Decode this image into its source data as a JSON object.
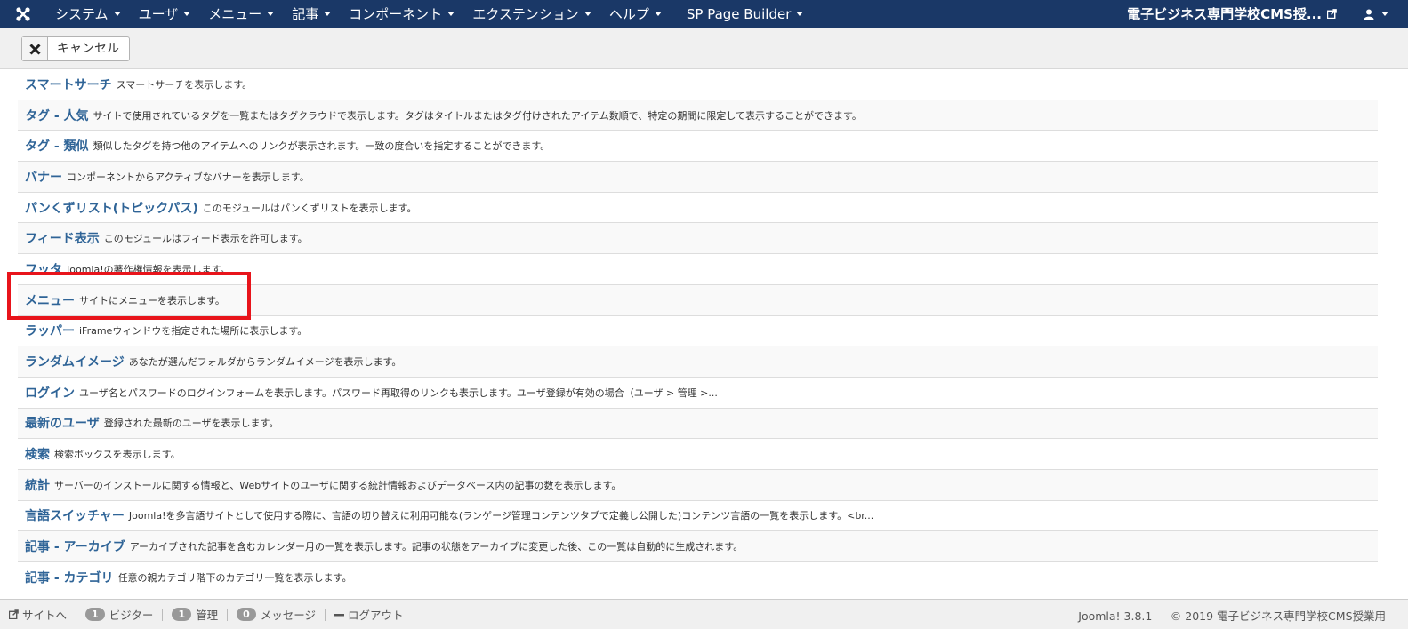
{
  "navbar": {
    "menus": [
      {
        "label": "システム"
      },
      {
        "label": "ユーザ"
      },
      {
        "label": "メニュー"
      },
      {
        "label": "記事"
      },
      {
        "label": "コンポーネント"
      },
      {
        "label": "エクステンション"
      },
      {
        "label": "ヘルプ"
      }
    ],
    "sp_page_builder": "SP Page Builder",
    "site_title": "電子ビジネス専門学校CMS授..."
  },
  "toolbar": {
    "cancel_label": "キャンセル"
  },
  "modules": [
    {
      "title": "スマートサーチ",
      "desc": "スマートサーチを表示します。"
    },
    {
      "title": "タグ - 人気",
      "desc": "サイトで使用されているタグを一覧またはタグクラウドで表示します。タグはタイトルまたはタグ付けされたアイテム数順で、特定の期間に限定して表示することができます。"
    },
    {
      "title": "タグ - 類似",
      "desc": "類似したタグを持つ他のアイテムへのリンクが表示されます。一致の度合いを指定することができます。"
    },
    {
      "title": "バナー",
      "desc": "コンポーネントからアクティブなバナーを表示します。"
    },
    {
      "title": "パンくずリスト(トピックパス)",
      "desc": "このモジュールはパンくずリストを表示します。"
    },
    {
      "title": "フィード表示",
      "desc": "このモジュールはフィード表示を許可します。"
    },
    {
      "title": "フッタ",
      "desc": "Joomla!の著作権情報を表示します。"
    },
    {
      "title": "メニュー",
      "desc": "サイトにメニューを表示します。"
    },
    {
      "title": "ラッパー",
      "desc": "iFrameウィンドウを指定された場所に表示します。"
    },
    {
      "title": "ランダムイメージ",
      "desc": "あなたが選んだフォルダからランダムイメージを表示します。"
    },
    {
      "title": "ログイン",
      "desc": "ユーザ名とパスワードのログインフォームを表示します。パスワード再取得のリンクも表示します。ユーザ登録が有効の場合（ユーザ > 管理 >..."
    },
    {
      "title": "最新のユーザ",
      "desc": "登録された最新のユーザを表示します。"
    },
    {
      "title": "検索",
      "desc": "検索ボックスを表示します。"
    },
    {
      "title": "統計",
      "desc": "サーバーのインストールに関する情報と、Webサイトのユーザに関する統計情報およびデータベース内の記事の数を表示します。"
    },
    {
      "title": "言語スイッチャー",
      "desc": "Joomla!を多言語サイトとして使用する際に、言語の切り替えに利用可能な(ランゲージ管理コンテンツタブで定義し公開した)コンテンツ言語の一覧を表示します。<br..."
    },
    {
      "title": "記事 - アーカイブ",
      "desc": "アーカイブされた記事を含むカレンダー月の一覧を表示します。記事の状態をアーカイブに変更した後、この一覧は自動的に生成されます。"
    },
    {
      "title": "記事 - カテゴリ",
      "desc": "任意の親カテゴリ階下のカテゴリ一覧を表示します。"
    }
  ],
  "statusbar": {
    "site_link": "サイトへ",
    "visitors_count": "1",
    "visitors_label": "ビジター",
    "admins_count": "1",
    "admins_label": "管理",
    "messages_count": "0",
    "messages_label": "メッセージ",
    "logout_label": "ログアウト",
    "copyright": "Joomla! 3.8.1 — © 2019 電子ビジネス専門学校CMS授業用"
  },
  "colors": {
    "navbar_bg": "#1a3867",
    "link": "#2f6497",
    "highlight": "#e8141b"
  }
}
